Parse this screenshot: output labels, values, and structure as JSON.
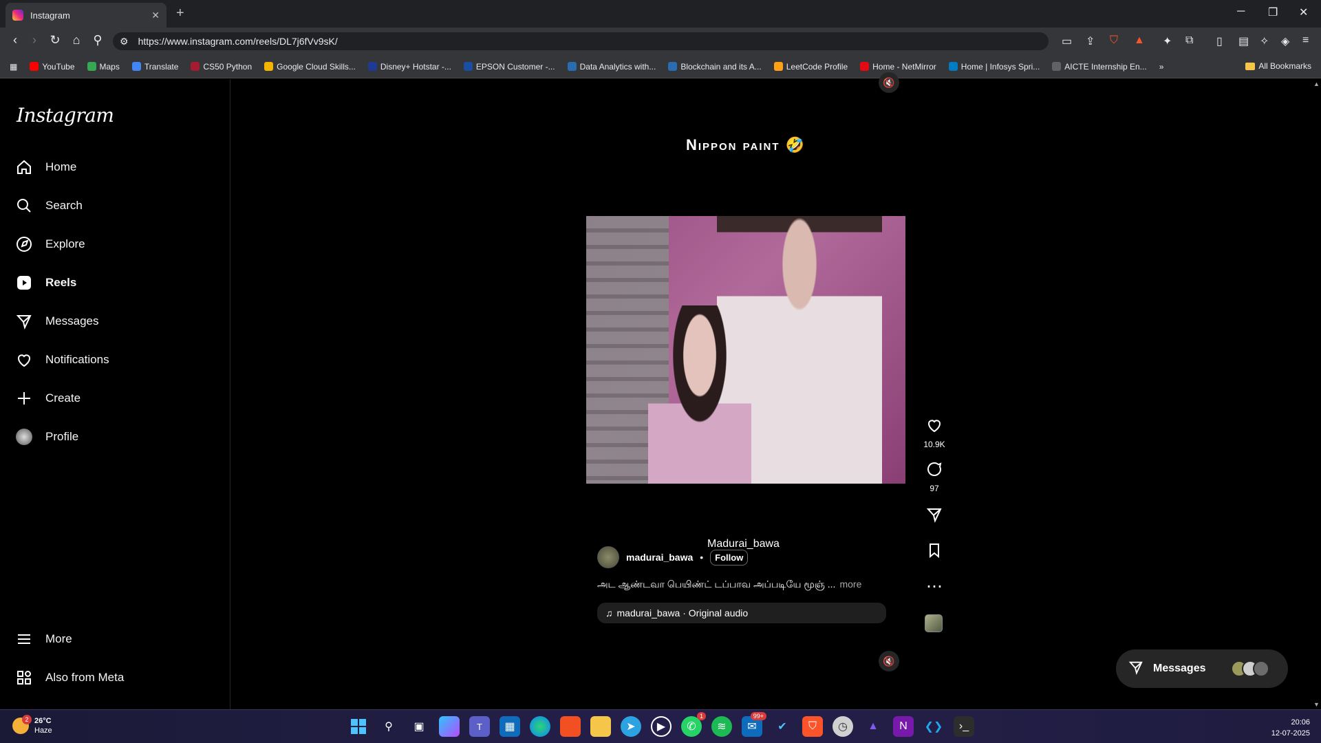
{
  "browser": {
    "tab_title": "Instagram",
    "url": "https://www.instagram.com/reels/DL7j6fVv9sK/",
    "bookmarks": [
      {
        "label": "YouTube",
        "color": "#ff0000"
      },
      {
        "label": "Maps",
        "color": "#34a853"
      },
      {
        "label": "Translate",
        "color": "#4285f4"
      },
      {
        "label": "CS50 Python",
        "color": "#a51c30"
      },
      {
        "label": "Google Cloud Skills...",
        "color": "#f4b400"
      },
      {
        "label": "Disney+ Hotstar -...",
        "color": "#1f3a93"
      },
      {
        "label": "EPSON Customer -...",
        "color": "#1a4ea1"
      },
      {
        "label": "Data Analytics with...",
        "color": "#2b6cb0"
      },
      {
        "label": "Blockchain and its A...",
        "color": "#2b6cb0"
      },
      {
        "label": "LeetCode Profile",
        "color": "#ffa116"
      },
      {
        "label": "Home - NetMirror",
        "color": "#e50914"
      },
      {
        "label": "Home | Infosys Spri...",
        "color": "#007cc3"
      },
      {
        "label": "AICTE Internship En...",
        "color": "#5f6368"
      }
    ],
    "all_bookmarks": "All Bookmarks"
  },
  "instagram": {
    "logo": "Instagram",
    "nav": [
      {
        "label": "Home",
        "icon": "home-icon"
      },
      {
        "label": "Search",
        "icon": "search-icon"
      },
      {
        "label": "Explore",
        "icon": "compass-icon"
      },
      {
        "label": "Reels",
        "icon": "reels-icon"
      },
      {
        "label": "Messages",
        "icon": "paper-plane-icon"
      },
      {
        "label": "Notifications",
        "icon": "heart-icon"
      },
      {
        "label": "Create",
        "icon": "plus-icon"
      },
      {
        "label": "Profile",
        "icon": "avatar-icon"
      }
    ],
    "nav_bottom": [
      {
        "label": "More",
        "icon": "menu-icon"
      },
      {
        "label": "Also from Meta",
        "icon": "meta-grid-icon"
      }
    ]
  },
  "reel": {
    "title": "Nippon paint 🤣",
    "overlay_tag": "Madurai_bawa",
    "author": "madurai_bawa",
    "separator": "•",
    "follow": "Follow",
    "caption": "அட ஆண்டவா பெயிண்ட் டப்பாவ அப்படியே மூஞ் ...",
    "more": "more",
    "audio": "madurai_bawa · Original audio",
    "likes": "10.9K",
    "comments": "97"
  },
  "messages_pill": "Messages",
  "taskbar": {
    "temperature": "26°C",
    "weather": "Haze",
    "weather_badge": "2",
    "whatsapp_badge": "1",
    "outlook_badge": "99+",
    "time": "20:06",
    "date": "12-07-2025"
  },
  "colors": {
    "background": "#000000",
    "chrome": "#35363a",
    "instagram_text": "#f5f5f5"
  }
}
